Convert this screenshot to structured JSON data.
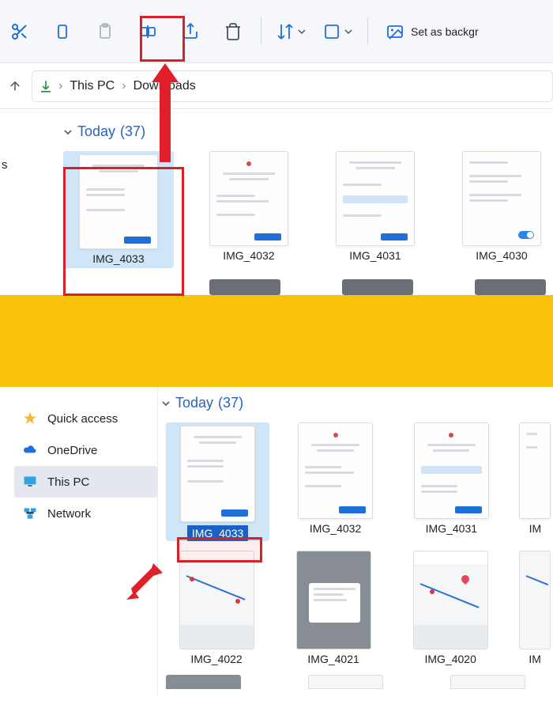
{
  "toolbar": {
    "set_background": "Set as backgr"
  },
  "breadcrumb": {
    "segments": [
      "This PC",
      "Downloads"
    ],
    "truncated_left": "s"
  },
  "top_grid": {
    "group_label": "Today",
    "group_count": "(37)",
    "items": [
      {
        "name": "IMG_4033",
        "selected": true
      },
      {
        "name": "IMG_4032",
        "selected": false
      },
      {
        "name": "IMG_4031",
        "selected": false
      },
      {
        "name": "IMG_4030",
        "selected": false
      }
    ]
  },
  "sidebar": {
    "items": [
      {
        "label": "Quick access",
        "icon": "star"
      },
      {
        "label": "OneDrive",
        "icon": "cloud"
      },
      {
        "label": "This PC",
        "icon": "monitor",
        "active": true
      },
      {
        "label": "Network",
        "icon": "network"
      }
    ]
  },
  "bottom_grid": {
    "group_label": "Today",
    "group_count": "(37)",
    "rows": [
      [
        {
          "name": "IMG_4033",
          "selected": true,
          "editing": true,
          "type": "doc"
        },
        {
          "name": "IMG_4032",
          "type": "doc"
        },
        {
          "name": "IMG_4031",
          "type": "doc"
        },
        {
          "name": "IM",
          "type": "doc",
          "partial": true
        }
      ],
      [
        {
          "name": "IMG_4022",
          "type": "map"
        },
        {
          "name": "IMG_4021",
          "type": "gray"
        },
        {
          "name": "IMG_4020",
          "type": "map"
        },
        {
          "name": "IM",
          "type": "map",
          "partial": true
        }
      ]
    ]
  }
}
